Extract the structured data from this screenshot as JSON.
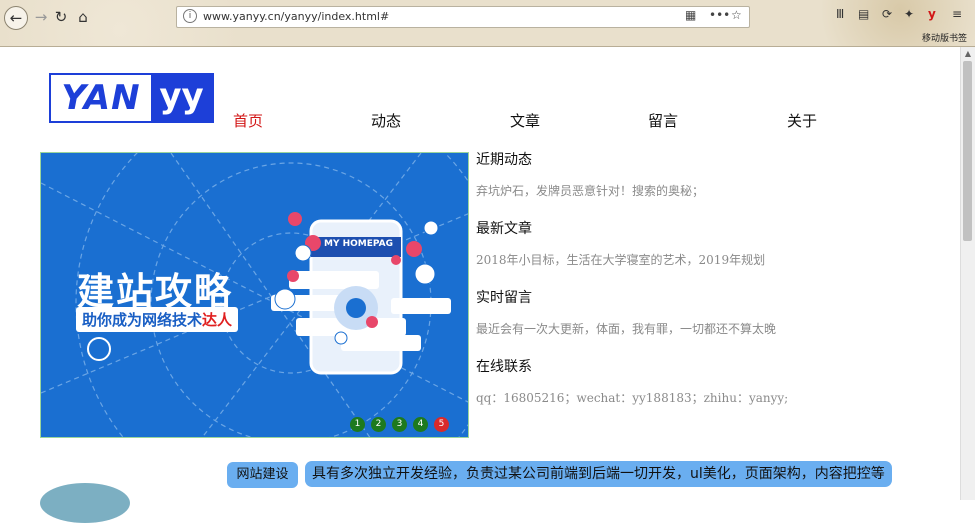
{
  "browser": {
    "url": "www.yanyy.cn/yanyy/index.html#",
    "info_icon": "i",
    "mobile_bookmarks": "移动版书签"
  },
  "logo": {
    "left": "YAN",
    "right": "yy"
  },
  "nav": [
    {
      "label": "首页",
      "active": true
    },
    {
      "label": "动态",
      "active": false
    },
    {
      "label": "文章",
      "active": false
    },
    {
      "label": "留言",
      "active": false
    },
    {
      "label": "关于",
      "active": false
    }
  ],
  "banner": {
    "title": "建站攻略",
    "subtitle_main": "助你成为网络技术",
    "subtitle_red": "达人",
    "phone_label": "MY HOMEPAG",
    "pages": [
      "1",
      "2",
      "3",
      "4",
      "5"
    ],
    "active_page": "5"
  },
  "sections": [
    {
      "title": "近期动态",
      "text": "弃坑炉石，发牌员恶意针对！搜索的奥秘；"
    },
    {
      "title": "最新文章",
      "text": "2018年小目标，生活在大学寝室的艺术，2019年规划"
    },
    {
      "title": "实时留言",
      "text": "最近会有一次大更新，体面，我有罪，一切都还不算太晚"
    },
    {
      "title": "在线联系",
      "text": "qq：16805216；wechat：yy188183；zhihu：yanyy;"
    }
  ],
  "footer": {
    "tag": "网站建设",
    "tagline": "具有多次独立开发经验，负责过某公司前端到后端一切开发，ul美化，页面架构，内容把控等"
  },
  "colors": {
    "brand": "#1d3fd8",
    "active_nav": "#d21515",
    "banner_bg": "#1a6fd1",
    "tag_bg": "#6aaef0"
  }
}
